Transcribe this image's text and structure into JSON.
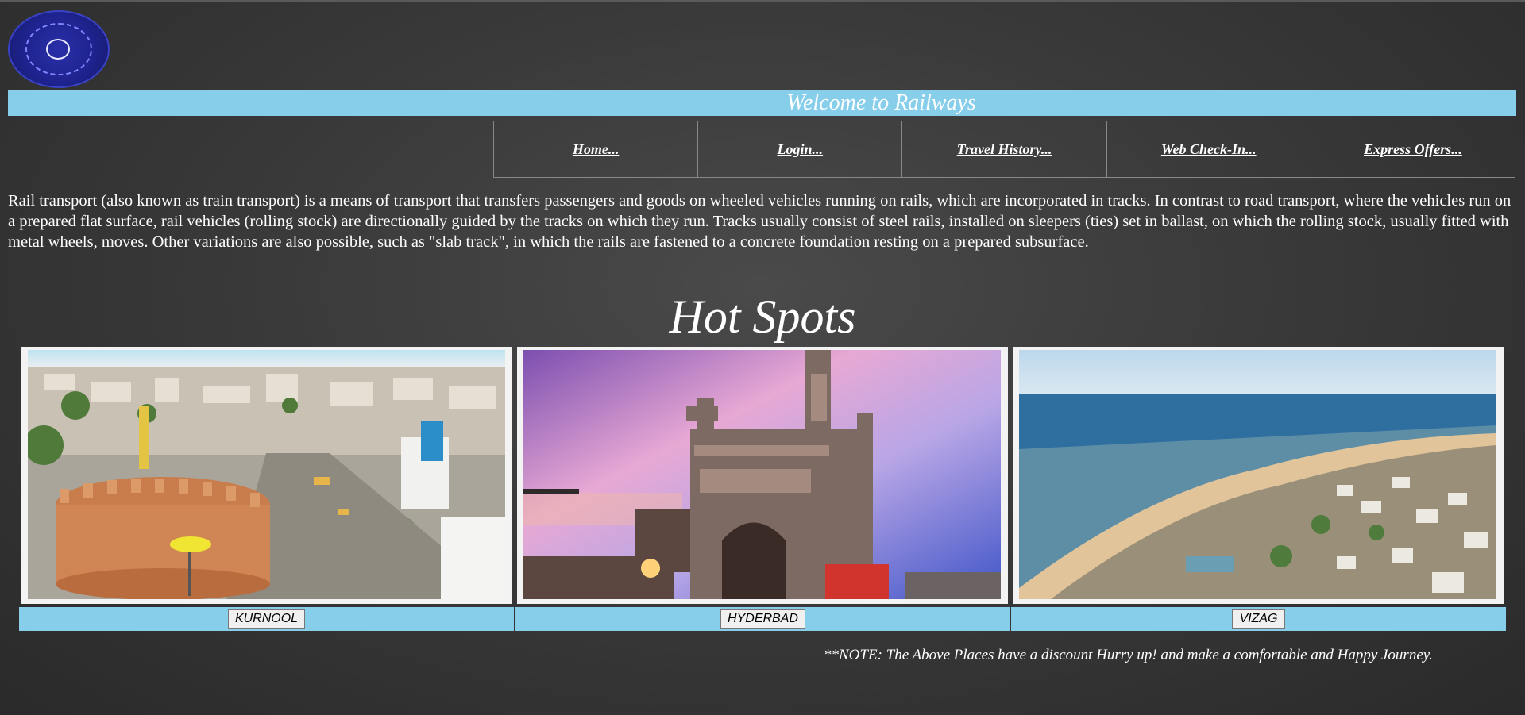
{
  "header": {
    "logo_icon": "indian-railways-logo-icon",
    "banner_title": "Welcome to Railways"
  },
  "nav": {
    "items": [
      {
        "label": "Home..."
      },
      {
        "label": "Login..."
      },
      {
        "label": "Travel History..."
      },
      {
        "label": "Web Check-In..."
      },
      {
        "label": "Express Offers..."
      }
    ]
  },
  "intro": {
    "text": "Rail transport (also known as train transport) is a means of transport that transfers passengers and goods on wheeled vehicles running on rails, which are incorporated in tracks. In contrast to road transport, where the vehicles run on a prepared flat surface, rail vehicles (rolling stock) are directionally guided by the tracks on which they run. Tracks usually consist of steel rails, installed on sleepers (ties) set in ballast, on which the rolling stock, usually fitted with metal wheels, moves. Other variations are also possible, such as \"slab track\", in which the rails are fastened to a concrete foundation resting on a prepared subsurface."
  },
  "hotspots": {
    "title": "Hot Spots",
    "places": [
      {
        "name": "KURNOOL"
      },
      {
        "name": "HYDERBAD"
      },
      {
        "name": "VIZAG"
      }
    ]
  },
  "note": {
    "text": "**NOTE: The Above Places have a discount Hurry up! and make a comfortable and Happy Journey."
  },
  "colors": {
    "banner": "#87ceeb",
    "background": "#3a3a3a"
  }
}
